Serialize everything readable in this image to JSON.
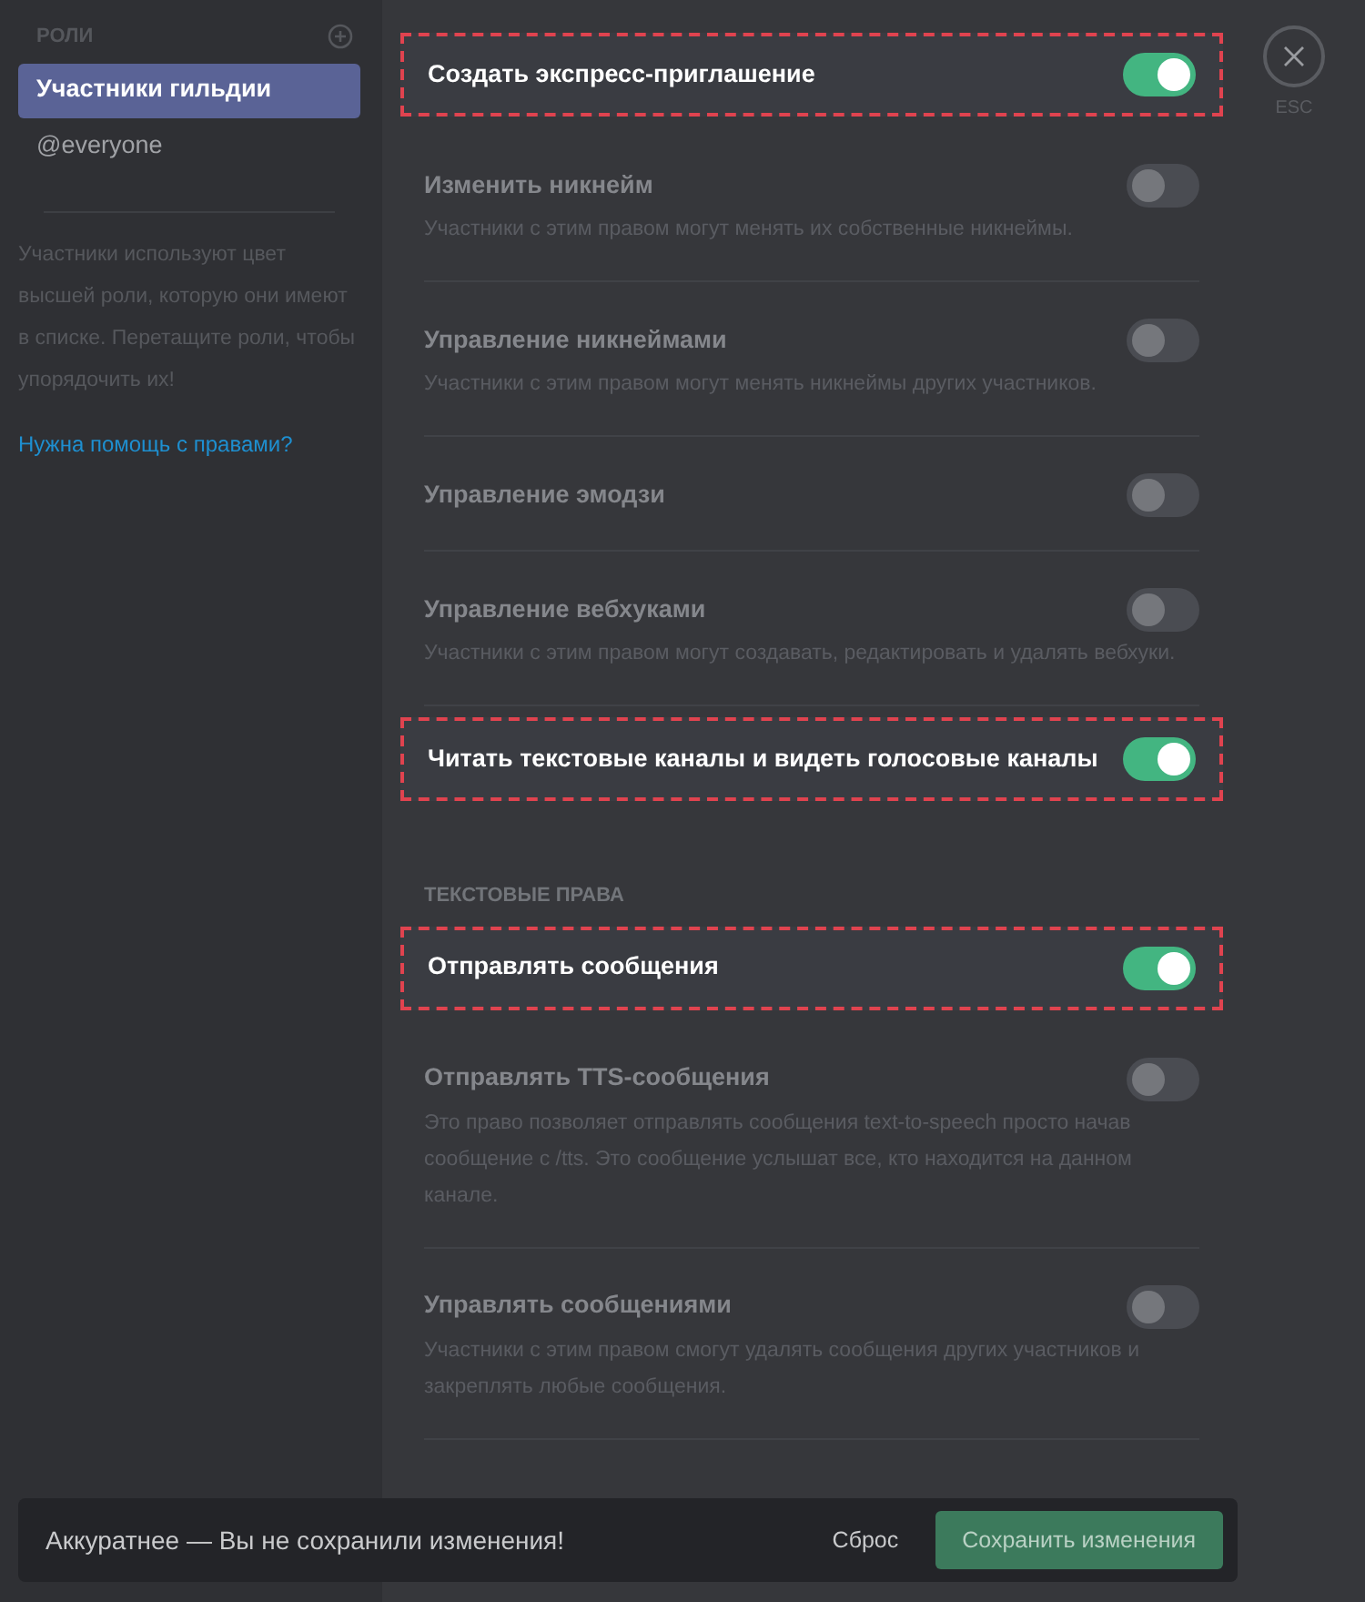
{
  "sidebar": {
    "header": "РОЛИ",
    "roles": [
      {
        "label": "Участники гильдии",
        "selected": true
      },
      {
        "label": "@everyone",
        "selected": false
      }
    ],
    "hint": "Участники используют цвет высшей роли, которую они имеют в списке. Перетащите роли, чтобы упорядочить их!",
    "help_link": "Нужна помощь с правами?"
  },
  "permissions": [
    {
      "kind": "permission",
      "name": "Создать экспресс-приглашение",
      "on": true,
      "highlighted": true
    },
    {
      "kind": "permission",
      "name": "Изменить никнейм",
      "description": "Участники с этим правом могут менять их собственные никнеймы.",
      "on": false,
      "highlighted": false
    },
    {
      "kind": "permission",
      "name": "Управление никнеймами",
      "description": "Участники с этим правом могут менять никнеймы других участников.",
      "on": false,
      "highlighted": false
    },
    {
      "kind": "permission",
      "name": "Управление эмодзи",
      "on": false,
      "highlighted": false
    },
    {
      "kind": "permission",
      "name": "Управление вебхуками",
      "description": "Участники с этим правом могут создавать, редактировать и удалять вебхуки.",
      "on": false,
      "highlighted": false
    },
    {
      "kind": "permission",
      "name": "Читать текстовые каналы и видеть голосовые каналы",
      "on": true,
      "highlighted": true
    },
    {
      "kind": "section",
      "name": "ТЕКСТОВЫЕ ПРАВА"
    },
    {
      "kind": "permission",
      "name": "Отправлять сообщения",
      "on": true,
      "highlighted": true
    },
    {
      "kind": "permission",
      "name": "Отправлять TTS-сообщения",
      "description": "Это право позволяет отправлять сообщения text-to-speech просто начав сообщение с /tts. Это сообщение услышат все, кто находится на данном канале.",
      "on": false,
      "highlighted": false
    },
    {
      "kind": "permission",
      "name": "Управлять сообщениями",
      "description": "Участники с этим правом смогут удалять сообщения других участников и закреплять любые сообщения.",
      "on": false,
      "highlighted": false
    }
  ],
  "close": {
    "label": "ESC"
  },
  "notice": {
    "text": "Аккуратнее — Вы не сохранили изменения!",
    "reset": "Сброс",
    "save": "Сохранить изменения"
  }
}
